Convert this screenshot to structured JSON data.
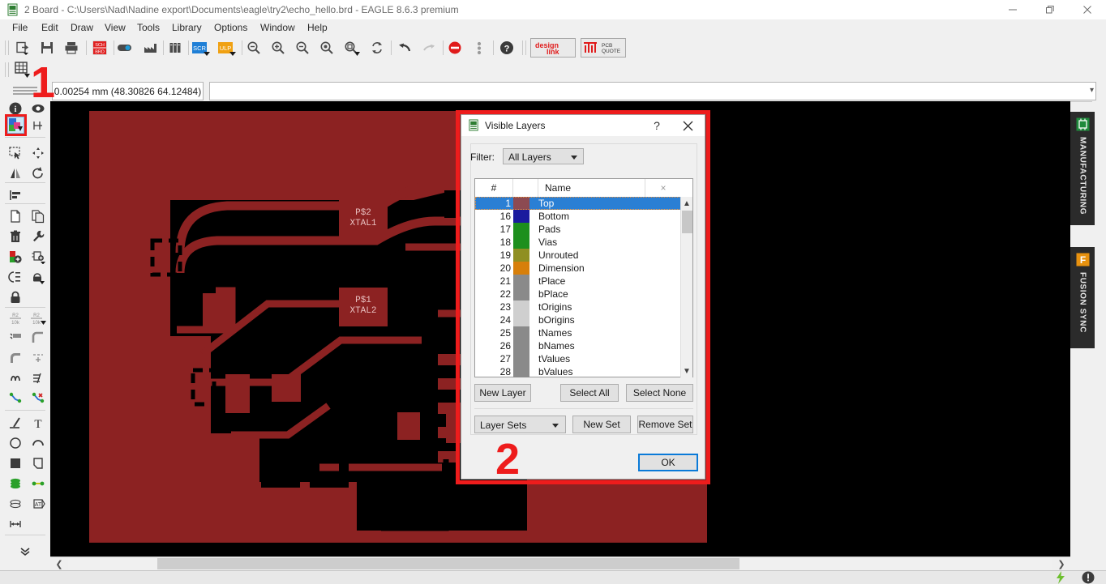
{
  "window": {
    "title": "2 Board - C:\\Users\\Nad\\Nadine export\\Documents\\eagle\\try2\\echo_hello.brd - EAGLE 8.6.3 premium",
    "app_icon": "brd-file-icon",
    "controls": {
      "minimize": "minimize-icon",
      "maximize": "restore-icon",
      "close": "close-icon"
    }
  },
  "menubar": {
    "items": [
      {
        "label": "File"
      },
      {
        "label": "Edit"
      },
      {
        "label": "Draw"
      },
      {
        "label": "View"
      },
      {
        "label": "Tools"
      },
      {
        "label": "Library"
      },
      {
        "label": "Options"
      },
      {
        "label": "Window"
      },
      {
        "label": "Help"
      }
    ]
  },
  "toolbar": {
    "items": [
      {
        "name": "open-icon"
      },
      {
        "name": "save-icon"
      },
      {
        "name": "print-icon"
      },
      {
        "name": "sch-brd-switch-icon"
      },
      {
        "name": "cam-processor-icon"
      },
      {
        "name": "manufacturing-icon"
      },
      {
        "name": "library-icon"
      },
      {
        "name": "script-icon",
        "label": "SCR"
      },
      {
        "name": "ulp-icon",
        "label": "ULP"
      },
      {
        "name": "zoom-fit-icon"
      },
      {
        "name": "zoom-in-icon"
      },
      {
        "name": "zoom-out-icon"
      },
      {
        "name": "zoom-select-icon"
      },
      {
        "name": "redraw-icon"
      },
      {
        "name": "undo-icon"
      },
      {
        "name": "redo-icon"
      },
      {
        "name": "stop-icon"
      },
      {
        "name": "drc-dots-icon"
      },
      {
        "name": "help-icon"
      }
    ],
    "design_link": {
      "line1": "design",
      "line2": "link"
    },
    "pcb_quote": {
      "line1": "PCB",
      "line2": "QUOTE"
    }
  },
  "grid_toolbar": {
    "grid_icon": "grid-icon"
  },
  "coordbar": {
    "coordinates": "0.00254 mm (48.30826 64.12484)",
    "command_value": "",
    "command_placeholder": ""
  },
  "left_palette": {
    "highlighted_tool": "display-layers-tool",
    "tools": [
      {
        "name": "info-tool"
      },
      {
        "name": "show-tool"
      },
      {
        "name": "display-layers-tool"
      },
      {
        "name": "mark-tool"
      },
      {
        "name": "group-tool"
      },
      {
        "name": "move-tool"
      },
      {
        "name": "mirror-tool"
      },
      {
        "name": "rotate-tool"
      },
      {
        "name": "align-tool"
      },
      {
        "name": "copy-tool"
      },
      {
        "name": "paste-tool"
      },
      {
        "name": "delete-tool"
      },
      {
        "name": "change-tool"
      },
      {
        "name": "add-part-tool"
      },
      {
        "name": "replace-tool"
      },
      {
        "name": "name-tool"
      },
      {
        "name": "lock-smash-tool"
      },
      {
        "name": "lock-tool"
      },
      {
        "name": "value-tool"
      },
      {
        "name": "smash-tool"
      },
      {
        "name": "pin-tool"
      },
      {
        "name": "arc-tool"
      },
      {
        "name": "polygon-tool"
      },
      {
        "name": "ratsnest-tool"
      },
      {
        "name": "signal-tool"
      },
      {
        "name": "meander-tool"
      },
      {
        "name": "route-tool"
      },
      {
        "name": "ripup-tool"
      },
      {
        "name": "wire-tool"
      },
      {
        "name": "text-tool"
      },
      {
        "name": "circle-tool"
      },
      {
        "name": "arc2-tool"
      },
      {
        "name": "rect-tool"
      },
      {
        "name": "polygon2-tool"
      },
      {
        "name": "via-tool"
      },
      {
        "name": "hole-tool"
      },
      {
        "name": "pad-tool"
      },
      {
        "name": "attribute-tool"
      },
      {
        "name": "dimension-tool"
      }
    ],
    "expand": "more-tools-chevron-icon"
  },
  "canvas": {
    "background": "#000000",
    "board_color": "#8c2222",
    "labels": [
      {
        "text": "P$2",
        "sub": "XTAL1"
      },
      {
        "text": "P$1",
        "sub": "XTAL2"
      }
    ]
  },
  "right_tabs": [
    {
      "label": "MANUFACTURING",
      "icon": "manufacturing-chip-icon",
      "color": "#1f8a3c"
    },
    {
      "label": "FUSION SYNC",
      "icon": "fusion-f-icon",
      "color": "#e8920f"
    }
  ],
  "statusbar": {
    "icons": [
      {
        "name": "autodesk-lightning-icon",
        "color": "#6dbf2e"
      },
      {
        "name": "notification-icon",
        "color": "#3c3c3c"
      }
    ]
  },
  "dialog": {
    "title": "Visible Layers",
    "icon": "brd-file-icon",
    "help_label": "?",
    "close_label": "close-icon",
    "filter": {
      "label": "Filter:",
      "value": "All Layers"
    },
    "list": {
      "headers": [
        "#",
        "",
        "Name",
        "×"
      ],
      "rows": [
        {
          "num": "1",
          "name": "Top",
          "color": "#8c4a52",
          "selected": true
        },
        {
          "num": "16",
          "name": "Bottom",
          "color": "#1b1b9e",
          "selected": false
        },
        {
          "num": "17",
          "name": "Pads",
          "color": "#1d8f1d",
          "selected": false
        },
        {
          "num": "18",
          "name": "Vias",
          "color": "#1d8f1d",
          "selected": false
        },
        {
          "num": "19",
          "name": "Unrouted",
          "color": "#8f8f22",
          "selected": false
        },
        {
          "num": "20",
          "name": "Dimension",
          "color": "#d77f0a",
          "selected": false
        },
        {
          "num": "21",
          "name": "tPlace",
          "color": "#8a8a8a",
          "selected": false
        },
        {
          "num": "22",
          "name": "bPlace",
          "color": "#8a8a8a",
          "selected": false
        },
        {
          "num": "23",
          "name": "tOrigins",
          "color": "#cfcfcf",
          "selected": false
        },
        {
          "num": "24",
          "name": "bOrigins",
          "color": "#cfcfcf",
          "selected": false
        },
        {
          "num": "25",
          "name": "tNames",
          "color": "#8a8a8a",
          "selected": false
        },
        {
          "num": "26",
          "name": "bNames",
          "color": "#8a8a8a",
          "selected": false
        },
        {
          "num": "27",
          "name": "tValues",
          "color": "#8a8a8a",
          "selected": false
        },
        {
          "num": "28",
          "name": "bValues",
          "color": "#8a8a8a",
          "selected": false
        }
      ]
    },
    "buttons": {
      "new_layer": "New Layer",
      "select_all": "Select All",
      "select_none": "Select None",
      "layer_sets": "Layer Sets",
      "new_set": "New Set",
      "remove_set": "Remove Set",
      "ok": "OK"
    }
  },
  "annotations": [
    {
      "label": "1"
    },
    {
      "label": "2"
    }
  ]
}
